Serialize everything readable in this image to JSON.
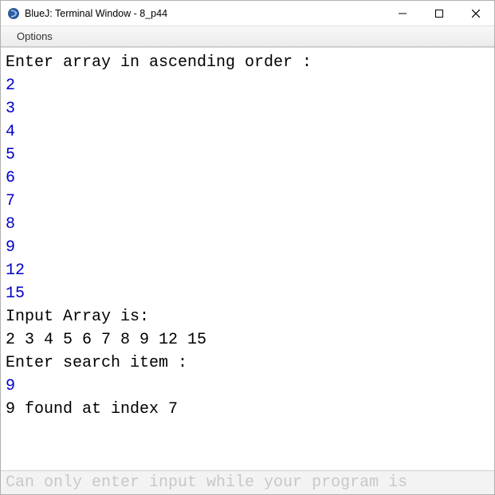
{
  "window": {
    "title": "BlueJ: Terminal Window - 8_p44"
  },
  "menu": {
    "options": "Options"
  },
  "terminal": {
    "lines": [
      {
        "text": "Enter array in ascending order :",
        "kind": "out"
      },
      {
        "text": "2",
        "kind": "inp"
      },
      {
        "text": "3",
        "kind": "inp"
      },
      {
        "text": "4",
        "kind": "inp"
      },
      {
        "text": "5",
        "kind": "inp"
      },
      {
        "text": "6",
        "kind": "inp"
      },
      {
        "text": "7",
        "kind": "inp"
      },
      {
        "text": "8",
        "kind": "inp"
      },
      {
        "text": "9",
        "kind": "inp"
      },
      {
        "text": "12",
        "kind": "inp"
      },
      {
        "text": "15",
        "kind": "inp"
      },
      {
        "text": "Input Array is:",
        "kind": "out"
      },
      {
        "text": "2 3 4 5 6 7 8 9 12 15",
        "kind": "out"
      },
      {
        "text": "Enter search item :",
        "kind": "out"
      },
      {
        "text": "9",
        "kind": "inp"
      },
      {
        "text": "9 found at index 7",
        "kind": "out"
      }
    ]
  },
  "input_bar": {
    "placeholder": "Can only enter input while your program is"
  }
}
